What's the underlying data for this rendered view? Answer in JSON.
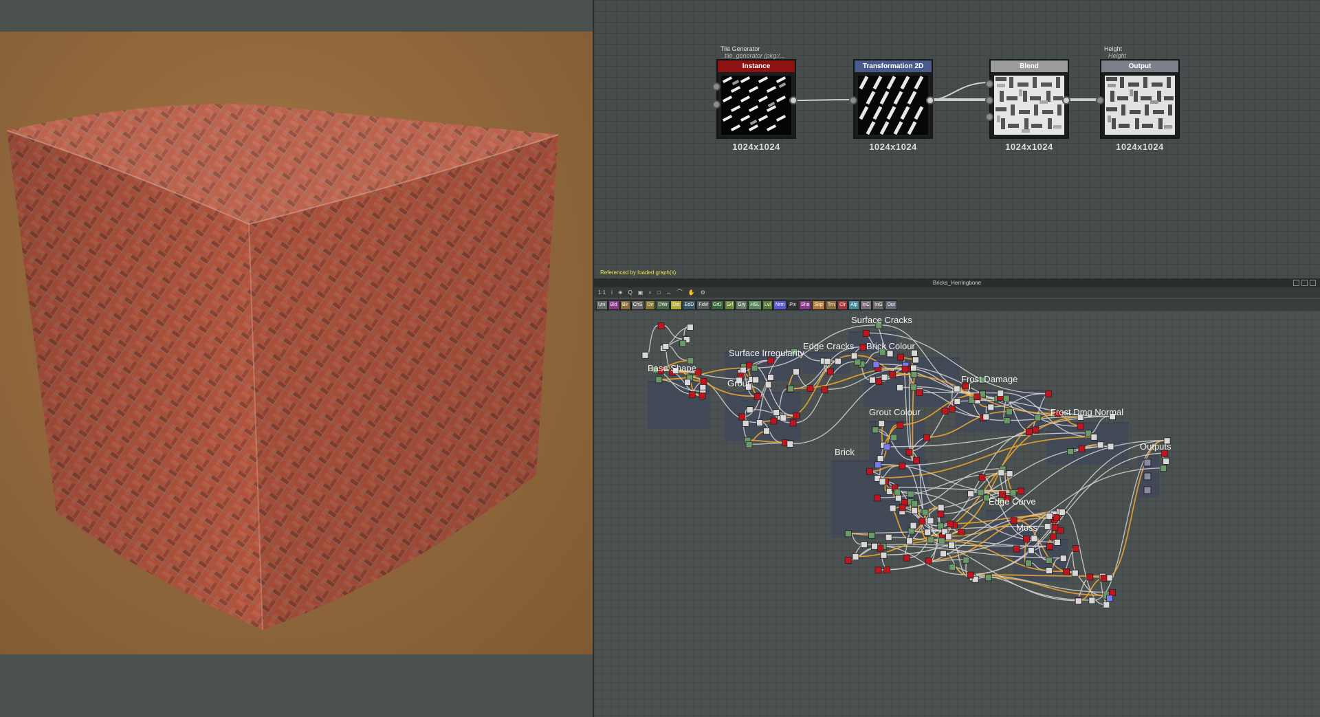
{
  "viewport": {
    "name": "3D View"
  },
  "top_graph": {
    "nodes": [
      {
        "header": "Instance",
        "resolution": "1024x1024",
        "label": "Tile Generator",
        "sublabel": "tile_generator (pkg:/...",
        "header_color": "#8e1212"
      },
      {
        "header": "Transformation 2D",
        "resolution": "1024x1024",
        "label": "",
        "sublabel": "",
        "header_color": "#4a5a8a"
      },
      {
        "header": "Blend",
        "resolution": "1024x1024",
        "label": "",
        "sublabel": "",
        "header_color": "#9b9b9b"
      },
      {
        "header": "Output",
        "resolution": "1024x1024",
        "label": "Height",
        "sublabel": "Height",
        "header_color": "#7d7f8a"
      }
    ],
    "referenced_text": "Referenced by loaded graph(s)"
  },
  "panel": {
    "title": "Bricks_Herringbone"
  },
  "toolbar1": {
    "items": [
      "1:1",
      "i",
      "⊕",
      "Q",
      "▣",
      "⌕",
      "□",
      "↔",
      "⌒",
      "✋",
      "⚙"
    ]
  },
  "toolbar2": {
    "chips": [
      {
        "label": "Uni",
        "color": "#6a6a6a"
      },
      {
        "label": "Bld",
        "color": "#8a3a8a"
      },
      {
        "label": "Blr",
        "color": "#8a6d3a"
      },
      {
        "label": "ChS",
        "color": "#6a6a6a"
      },
      {
        "label": "Dir",
        "color": "#8a7a3a"
      },
      {
        "label": "DWr",
        "color": "#4a6a4a"
      },
      {
        "label": "Dst",
        "color": "#b3a83a"
      },
      {
        "label": "EdD",
        "color": "#3a5a6a"
      },
      {
        "label": "FxM",
        "color": "#555a5a"
      },
      {
        "label": "GrD",
        "color": "#3a6a3a"
      },
      {
        "label": "Grl",
        "color": "#6a8a3a"
      },
      {
        "label": "Gry",
        "color": "#6a7a6a"
      },
      {
        "label": "HSL",
        "color": "#5a8a5a"
      },
      {
        "label": "Lvl",
        "color": "#5a7a3a"
      },
      {
        "label": "Nrm",
        "color": "#5a5ad0"
      },
      {
        "label": "Pix",
        "color": "#333"
      },
      {
        "label": "Sha",
        "color": "#8a3a8a"
      },
      {
        "label": "Shp",
        "color": "#b37a3a"
      },
      {
        "label": "Trn",
        "color": "#8a6d3a"
      },
      {
        "label": "Clr",
        "color": "#a03a3a"
      },
      {
        "label": "Alp",
        "color": "#4a8a9a"
      },
      {
        "label": "InC",
        "color": "#7a6a7a"
      },
      {
        "label": "InG",
        "color": "#6a6a6a"
      },
      {
        "label": "Out",
        "color": "#6a6a7a"
      }
    ]
  },
  "frames": [
    {
      "title": "Base Shape"
    },
    {
      "title": "Surface Irregularity"
    },
    {
      "title": "Edge Cracks"
    },
    {
      "title": "Surface Cracks"
    },
    {
      "title": "Brick Colour"
    },
    {
      "title": "Grout"
    },
    {
      "title": "Frost Damage"
    },
    {
      "title": "Grout Colour"
    },
    {
      "title": "Frost Dmg Normal"
    },
    {
      "title": "Brick"
    },
    {
      "title": "Outputs"
    },
    {
      "title": "Edge Curve"
    },
    {
      "title": "Moss"
    }
  ],
  "colors": {
    "node_red": "#c0141f",
    "node_gray": "#d8d8d8",
    "node_green": "#6a9a6a",
    "node_blue": "#7b7bf0",
    "link_gray": "#d2d2d2",
    "link_orange": "#f0a830"
  }
}
